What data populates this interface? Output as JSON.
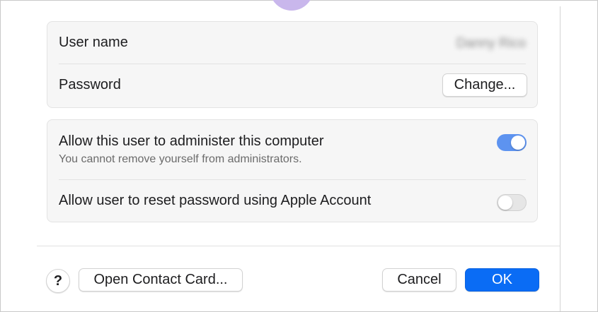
{
  "account": {
    "user_name_label": "User name",
    "user_name_value": "Danny Rico",
    "password_label": "Password",
    "change_button": "Change..."
  },
  "permissions": {
    "admin_label": "Allow this user to administer this computer",
    "admin_note": "You cannot remove yourself from administrators.",
    "admin_enabled": true,
    "reset_label": "Allow user to reset password using Apple Account",
    "reset_enabled": false
  },
  "footer": {
    "help_label": "?",
    "open_contact_card": "Open Contact Card...",
    "cancel": "Cancel",
    "ok": "OK"
  },
  "colors": {
    "accent": "#0a6cf5",
    "toggle_on": "#5d93f0",
    "avatar": "#c9b7ec"
  }
}
